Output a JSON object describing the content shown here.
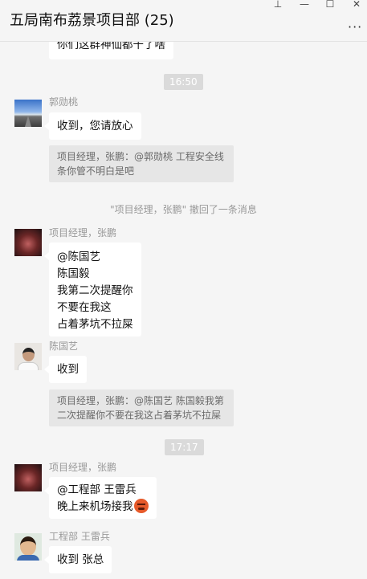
{
  "window": {
    "title": "五局南布荔景项目部 (25)",
    "more_label": "···",
    "pin_glyph": "⊥",
    "min_glyph": "—",
    "max_glyph": "☐",
    "close_glyph": "✕"
  },
  "messages": {
    "partial_top": "你们这群神仙都干了啥",
    "time1": "16:50",
    "m1": {
      "sender": "郭勋桃",
      "avatar_icon": "road-landscape-avatar",
      "text": "收到，您请放心",
      "quote_line1": "项目经理，张鹏：@郭勋桃 工程安全线",
      "quote_line2": "条你管不明白是吧"
    },
    "recall_notice": "\"项目经理，张鹏\" 撤回了一条消息",
    "m2": {
      "sender": "项目经理，张鹏",
      "avatar_icon": "dark-portrait-avatar",
      "lines": [
        "@陈国艺",
        "陈国毅",
        "我第二次提醒你",
        "不要在我这",
        "占着茅坑不拉屎"
      ]
    },
    "m3": {
      "sender": "陈国艺",
      "avatar_icon": "man-portrait-avatar",
      "text": "收到",
      "quote_line1": "项目经理，张鹏：@陈国艺 陈国毅我第",
      "quote_line2": "二次提醒你不要在我这占着茅坑不拉屎"
    },
    "time2": "17:17",
    "m4": {
      "sender": "项目经理，张鹏",
      "avatar_icon": "dark-portrait-avatar",
      "line1": "@工程部 王雷兵",
      "line2": "晚上来机场接我",
      "emoji_icon": "angry-face-emoji"
    },
    "m5": {
      "sender": "工程部 王雷兵",
      "avatar_icon": "child-portrait-avatar",
      "text": "收到 张总"
    }
  }
}
